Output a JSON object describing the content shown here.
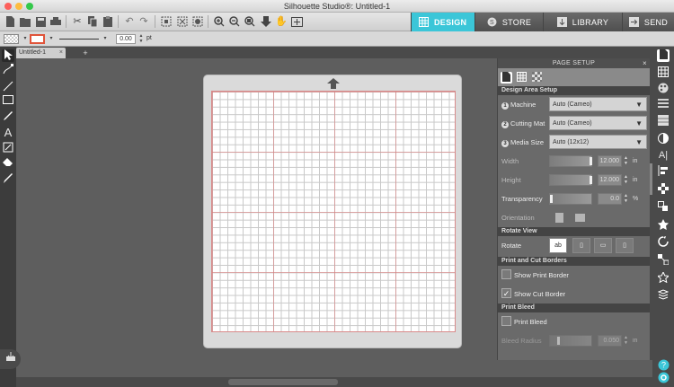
{
  "window": {
    "title": "Silhouette Studio®: Untitled-1"
  },
  "nav_tabs": [
    {
      "label": "DESIGN",
      "icon": "grid-icon"
    },
    {
      "label": "STORE",
      "icon": "store-icon"
    },
    {
      "label": "LIBRARY",
      "icon": "library-icon"
    },
    {
      "label": "SEND",
      "icon": "send-icon"
    }
  ],
  "colors": {
    "accent": "#3bc6d8",
    "grid_major": "#dc7878",
    "panel_bg": "#6a6a6a"
  },
  "options": {
    "line_width": "0.00",
    "unit": "pt"
  },
  "document_tab": {
    "label": "Untitled-1",
    "close": "×",
    "add": "+"
  },
  "panel": {
    "title": "PAGE SETUP",
    "close": "×",
    "design_area_setup": "Design Area Setup",
    "machine": {
      "label": "Machine",
      "value": "Auto (Cameo)",
      "num": "1"
    },
    "cutting_mat": {
      "label": "Cutting Mat",
      "value": "Auto (Cameo)",
      "num": "2"
    },
    "media_size": {
      "label": "Media Size",
      "value": "Auto (12x12)",
      "num": "3"
    },
    "width": {
      "label": "Width",
      "value": "12.000",
      "unit": "in"
    },
    "height": {
      "label": "Height",
      "value": "12.000",
      "unit": "in"
    },
    "transparency": {
      "label": "Transparency",
      "value": "0.0",
      "unit": "%"
    },
    "orientation": {
      "label": "Orientation"
    },
    "rotate_view": "Rotate View",
    "rotate": {
      "label": "Rotate",
      "active": "ab"
    },
    "print_cut_borders": "Print and Cut Borders",
    "show_print_border": {
      "label": "Show Print Border",
      "checked": false
    },
    "show_cut_border": {
      "label": "Show Cut Border",
      "checked": true
    },
    "print_bleed": "Print Bleed",
    "print_bleed_chk": {
      "label": "Print Bleed",
      "checked": false
    },
    "bleed_radius": {
      "label": "Bleed Radius",
      "value": "0.050",
      "unit": "in"
    }
  }
}
